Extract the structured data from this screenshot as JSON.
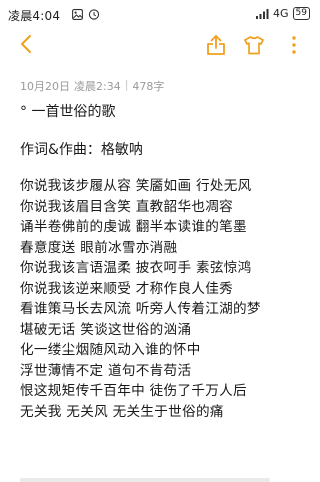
{
  "status_bar": {
    "time": "凌晨4:04",
    "network": "4G",
    "battery": "59"
  },
  "toolbar": {
    "back_icon": "chevron-left-icon",
    "share_icon": "share-icon",
    "theme_icon": "shirt-icon",
    "more_icon": "more-vertical-icon",
    "accent_color": "#f0a01f"
  },
  "note": {
    "date": "10月20日",
    "time": "凌晨2:34",
    "word_count": "478字",
    "title": "° 一首世俗的歌",
    "author": "作词&作曲：格敏呐",
    "lyrics": [
      "你说我该步履从容  笑靥如画  行处无风",
      "你说我该眉目含笑  直教韶华也凋容",
      "诵半卷佛前的虔诚  翻半本读谁的笔墨",
      "春意度送  眼前冰雪亦消融",
      "你说我该言语温柔  披衣呵手  素弦惊鸿",
      "你说我该逆来顺受  才称作良人佳秀",
      "看谁策马长去风流  听旁人传着江湖的梦",
      "堪破无话  笑谈这世俗的汹涌",
      "化一缕尘烟随风动入谁的怀中",
      "浮世薄情不定  道句不肯苟活",
      "恨这规矩传千百年中  徒伤了千万人后",
      "无关我  无关风  无关生于世俗的痛"
    ]
  }
}
